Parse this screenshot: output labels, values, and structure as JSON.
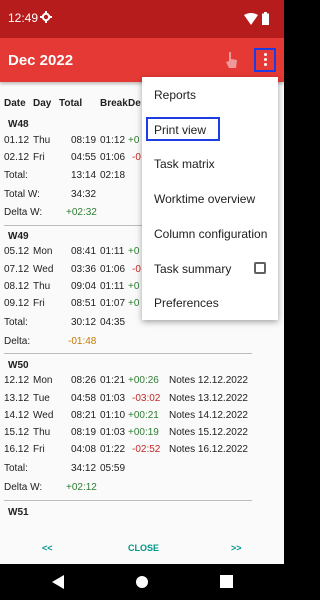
{
  "status": {
    "time": "12:49"
  },
  "appbar": {
    "title": "Dec 2022"
  },
  "table": {
    "headers": [
      "Date",
      "Day",
      "Total",
      "Break",
      "De"
    ],
    "weeks": [
      {
        "label": "W48",
        "rows": [
          [
            "01.12",
            "Thu",
            "08:19",
            "01:12",
            "+0"
          ],
          [
            "02.12",
            "Fri",
            "04:55",
            "01:06",
            "-0"
          ]
        ],
        "total": [
          "Total:",
          "13:14",
          "02:18"
        ],
        "total_w": [
          "Total W:",
          "34:32"
        ],
        "delta_w": [
          "Delta W:",
          "+02:32"
        ]
      },
      {
        "label": "W49",
        "rows": [
          [
            "05.12",
            "Mon",
            "08:41",
            "01:11",
            "+0"
          ],
          [
            "07.12",
            "Wed",
            "03:36",
            "01:06",
            "-0"
          ],
          [
            "08.12",
            "Thu",
            "09:04",
            "01:11",
            "+0"
          ],
          [
            "09.12",
            "Fri",
            "08:51",
            "01:07",
            "+0"
          ]
        ],
        "total": [
          "Total:",
          "30:12",
          "04:35"
        ],
        "delta": [
          "Delta:",
          "-01:48"
        ]
      },
      {
        "label": "W50",
        "rows": [
          [
            "12.12",
            "Mon",
            "08:26",
            "01:21",
            "+00:26",
            "Notes 12.12.2022"
          ],
          [
            "13.12",
            "Tue",
            "04:58",
            "01:03",
            "-03:02",
            "Notes 13.12.2022"
          ],
          [
            "14.12",
            "Wed",
            "08:21",
            "01:10",
            "+00:21",
            "Notes 14.12.2022"
          ],
          [
            "15.12",
            "Thu",
            "08:19",
            "01:03",
            "+00:19",
            "Notes 15.12.2022"
          ],
          [
            "16.12",
            "Fri",
            "04:08",
            "01:22",
            "-02:52",
            "Notes 16.12.2022"
          ]
        ],
        "total": [
          "Total:",
          "34:12",
          "05:59"
        ],
        "delta_w": [
          "Delta W:",
          "+02:12"
        ]
      },
      {
        "label": "W51"
      }
    ]
  },
  "bottom": {
    "prev": "<<",
    "close": "CLOSE",
    "next": ">>"
  },
  "menu": {
    "items": [
      "Reports",
      "Print view",
      "Task matrix",
      "Worktime overview",
      "Column configuration",
      "Task summary",
      "Preferences"
    ],
    "task_summary_checked": false
  },
  "colors": {
    "appbar": "#e53935",
    "statusbar": "#b71c1c",
    "accent": "#009688",
    "positive": "#2e7d32",
    "negative": "#c62828"
  }
}
